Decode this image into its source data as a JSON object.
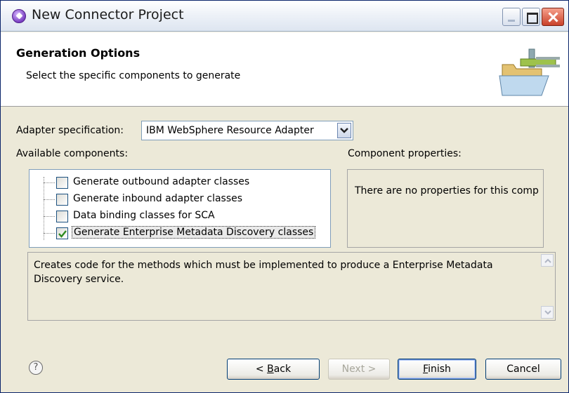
{
  "window": {
    "title": "New Connector Project"
  },
  "header": {
    "title": "Generation Options",
    "description": "Select the specific components to generate"
  },
  "adapter": {
    "label": "Adapter specification:",
    "selected": "IBM WebSphere Resource Adapter"
  },
  "components": {
    "label": "Available components:",
    "items": [
      {
        "label": "Generate outbound adapter classes",
        "checked": false
      },
      {
        "label": "Generate inbound adapter classes",
        "checked": false
      },
      {
        "label": "Data binding classes for SCA",
        "checked": false
      },
      {
        "label": "Generate Enterprise Metadata Discovery classes",
        "checked": true
      }
    ]
  },
  "properties": {
    "label": "Component properties:",
    "text": "There are no properties for this comp"
  },
  "description": {
    "text": "Creates code for the methods which must be implemented to produce a Enterprise Metadata Discovery service."
  },
  "buttons": {
    "help": "?",
    "back_prefix": "< ",
    "back_mnemonic": "B",
    "back_suffix": "ack",
    "next": "Next >",
    "finish_mnemonic": "F",
    "finish_suffix": "inish",
    "cancel": "Cancel"
  },
  "colors": {
    "accent": "#003c74",
    "check": "#2e8b20"
  }
}
